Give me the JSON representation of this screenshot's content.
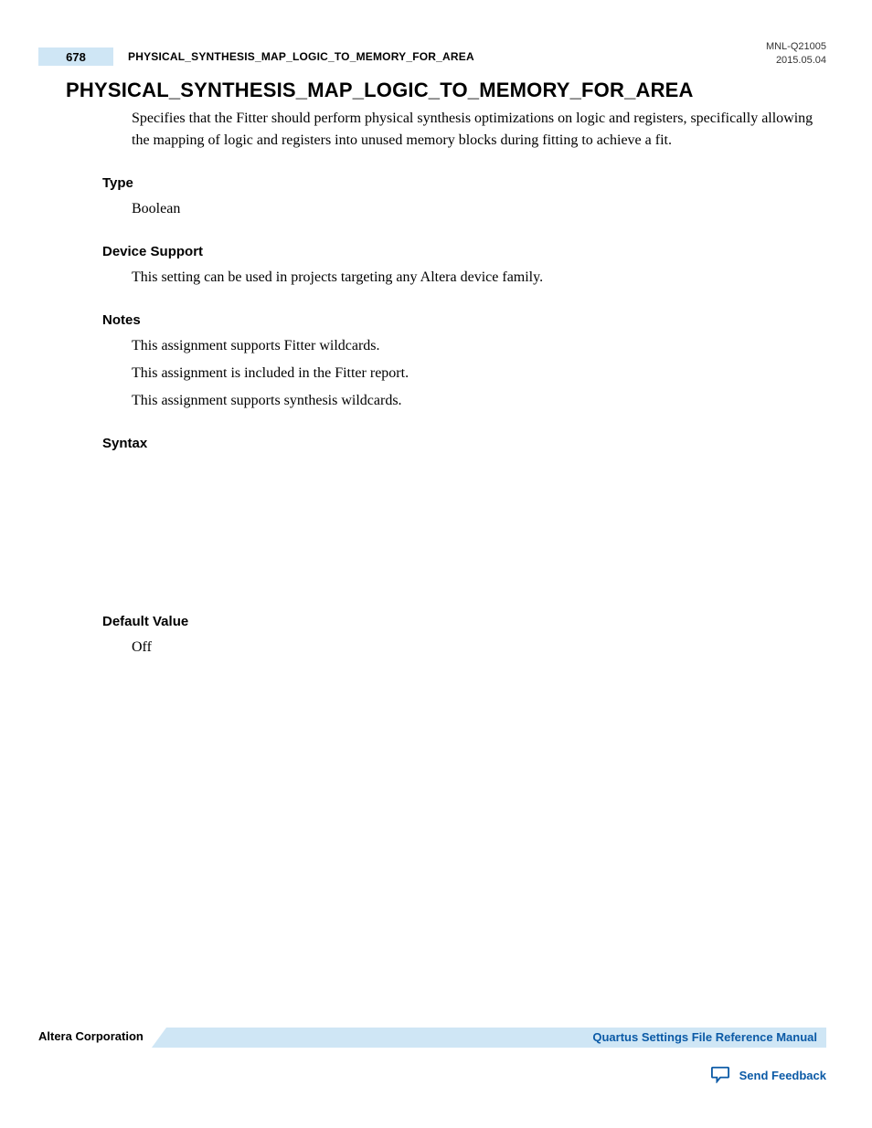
{
  "header": {
    "page_number": "678",
    "running_title": "PHYSICAL_SYNTHESIS_MAP_LOGIC_TO_MEMORY_FOR_AREA",
    "doc_id": "MNL-Q21005",
    "doc_date": "2015.05.04"
  },
  "title": "PHYSICAL_SYNTHESIS_MAP_LOGIC_TO_MEMORY_FOR_AREA",
  "intro": "Specifies that the Fitter should perform physical synthesis optimizations on logic and registers, specifically allowing the mapping of logic and registers into unused memory blocks during fitting to achieve a fit.",
  "sections": {
    "type": {
      "label": "Type",
      "body": "Boolean"
    },
    "device_support": {
      "label": "Device Support",
      "body": "This setting can be used in projects targeting any Altera device family."
    },
    "notes": {
      "label": "Notes",
      "lines": [
        "This assignment supports Fitter wildcards.",
        "This assignment is included in the Fitter report.",
        "This assignment supports synthesis wildcards."
      ]
    },
    "syntax": {
      "label": "Syntax"
    },
    "default_value": {
      "label": "Default Value",
      "body": "Off"
    }
  },
  "footer": {
    "left": "Altera Corporation",
    "right": "Quartus Settings File Reference Manual",
    "feedback": "Send Feedback"
  }
}
